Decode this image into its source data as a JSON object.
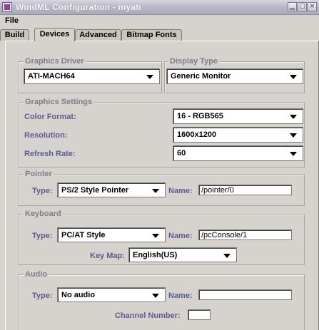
{
  "window": {
    "title": "WindML Configuration - myati",
    "controls": [
      "minimize",
      "maximize",
      "close"
    ]
  },
  "menu": {
    "file": "File"
  },
  "tabs": [
    {
      "label": "Build",
      "active": false
    },
    {
      "label": "Devices",
      "active": true
    },
    {
      "label": "Advanced",
      "active": false
    },
    {
      "label": "Bitmap Fonts",
      "active": false
    }
  ],
  "graphics_driver": {
    "legend": "Graphics Driver",
    "value": "ATI-MACH64"
  },
  "display_type": {
    "legend": "Display Type",
    "value": "Generic Monitor"
  },
  "graphics_settings": {
    "legend": "Graphics Settings",
    "color_format": {
      "label": "Color Format:",
      "value": "16 - RGB565"
    },
    "resolution": {
      "label": "Resolution:",
      "value": "1600x1200"
    },
    "refresh_rate": {
      "label": "Refresh Rate:",
      "value": "60"
    }
  },
  "pointer": {
    "legend": "Pointer",
    "type_label": "Type:",
    "type_value": "PS/2 Style Pointer",
    "name_label": "Name:",
    "name_value": "/pointer/0"
  },
  "keyboard": {
    "legend": "Keyboard",
    "type_label": "Type:",
    "type_value": "PC/AT Style",
    "name_label": "Name:",
    "name_value": "/pcConsole/1",
    "keymap_label": "Key Map:",
    "keymap_value": "English(US)"
  },
  "audio": {
    "legend": "Audio",
    "type_label": "Type:",
    "type_value": "No audio",
    "name_label": "Name:",
    "name_value": "",
    "channel_label": "Channel Number:",
    "channel_value": ""
  },
  "colors": {
    "label": "#5b5b90",
    "legend": "#7f7d8c",
    "background": "#d6d3ce"
  }
}
